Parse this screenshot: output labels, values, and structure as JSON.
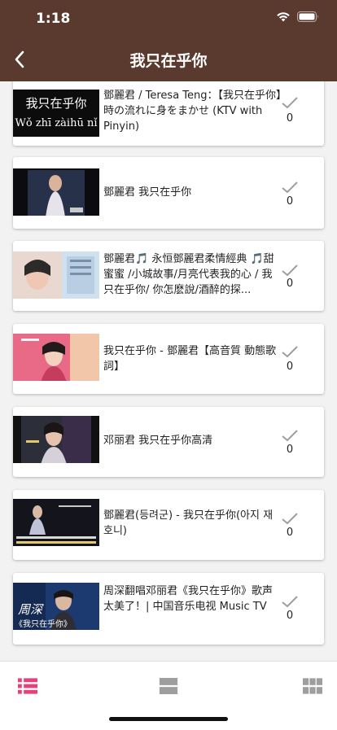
{
  "status_bar": {
    "time": "1:18"
  },
  "header": {
    "title": "我只在乎你"
  },
  "items": [
    {
      "title": "鄧麗君 / Teresa Teng：【我只在乎你】時の流れに身をまかせ (KTV with Pinyin)",
      "count": "0",
      "thumb_line1": "我只在乎你",
      "thumb_line2": "Wǒ zhī zàihū nǐ"
    },
    {
      "title": "鄧麗君 我只在乎你",
      "count": "0"
    },
    {
      "title": "鄧麗君🎵 永恒鄧麗君柔情經典 🎵甜蜜蜜 /小城故事/月亮代表我的心 / 我只在乎你/ 你怎麽說/酒醉的探...",
      "count": "0"
    },
    {
      "title": "我只在乎你 - 鄧麗君【高音質 動態歌詞】",
      "count": "0"
    },
    {
      "title": "邓丽君 我只在乎你高清",
      "count": "0"
    },
    {
      "title": "鄧麗君(등려군) - 我只在乎你(아지 재호니)",
      "count": "0"
    },
    {
      "title": "周深翻唱邓丽君《我只在乎你》歌声太美了！| 中国音乐电视 Music TV",
      "count": "0",
      "thumb_line1": "周深",
      "thumb_line2": "《我只在乎你》"
    }
  ],
  "colors": {
    "header_bg": "#5a3a2e",
    "accent": "#e8407a",
    "icon_gray": "#9e9e9e"
  }
}
